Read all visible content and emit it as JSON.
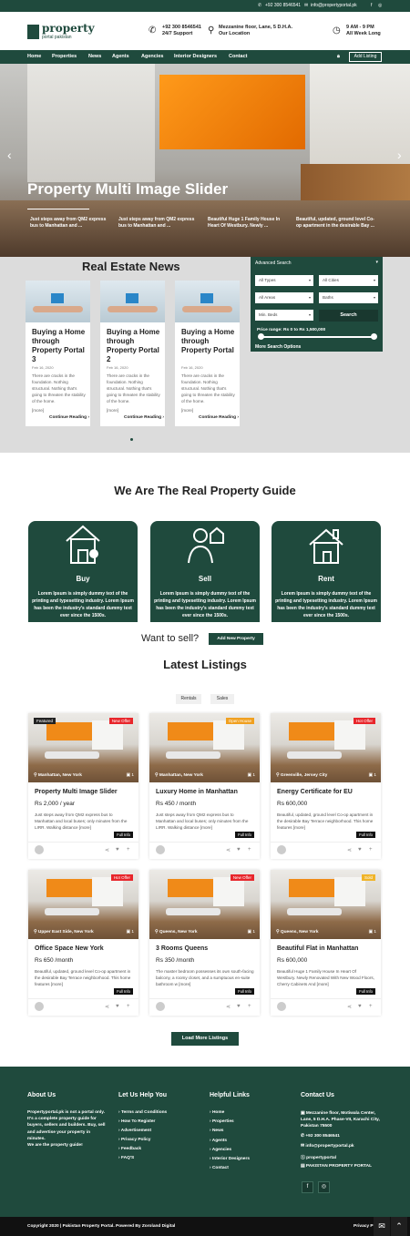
{
  "topbar": {
    "phone": "+92 300 8546541",
    "email": "info@propertyportal.pk",
    "icons": [
      "facebook-icon",
      "instagram-icon"
    ]
  },
  "header": {
    "logo_line1": "property",
    "logo_line2": "portal pakistan",
    "contact_line1": "+92 300 8546541",
    "contact_line2": "24/7 Support",
    "address_line1": "Mezzanine floor, Lane, 5 D.H.A.",
    "address_line2": "Our Location",
    "hours_line1": "9 AM - 9 PM",
    "hours_line2": "All Week Long"
  },
  "nav": {
    "items": [
      "Home",
      "Properties",
      "News",
      "Agents",
      "Agencies",
      "Interior Designers",
      "Contact"
    ],
    "add_listing": "Add Listing"
  },
  "slider": {
    "title": "Property Multi Image Slider",
    "captions": [
      "Just steps away from QM2 express bus to Manhattan and ...",
      "Just steps away from QM2 express bus to Manhattan and ...",
      "Beautiful Huge 1 Family House In Heart Of Westbury. Newly ...",
      "Beautiful, updated, ground level Co-op apartment in the desirable Bay ..."
    ],
    "prev": "‹",
    "next": "›"
  },
  "news": {
    "title": "Real Estate News",
    "cards": [
      {
        "title": "Buying a Home through Property Portal 3",
        "date": "Feb 16, 2020",
        "excerpt": "There are cracks in the foundation. Nothing structural. Nothing that's going to threaten the stability of the home.",
        "more": "[more]",
        "cta": "Continue Reading ›"
      },
      {
        "title": "Buying a Home through Property Portal 2",
        "date": "Feb 16, 2020",
        "excerpt": "There are cracks in the foundation. Nothing structural. Nothing that's going to threaten the stability of the home.",
        "more": "[more]",
        "cta": "Continue Reading ›"
      },
      {
        "title": "Buying a Home through Property Portal",
        "date": "Feb 16, 2020",
        "excerpt": "There are cracks in the foundation. Nothing structural. Nothing that's going to threaten the stability of the home.",
        "more": "[more]",
        "cta": "Continue Reading ›"
      }
    ]
  },
  "search": {
    "title": "Advanced Search",
    "types": "All Types",
    "cities": "All Cities",
    "areas": "All Areas",
    "baths": "Baths",
    "beds": "Min. Beds",
    "button": "Search",
    "price": "Price range: Rs 0 to Rs 1,500,000",
    "more": "More Search Options"
  },
  "guide": {
    "title": "We Are The Real Property Guide",
    "boxes": [
      {
        "label": "Buy",
        "text": "Lorem Ipsum is simply dummy text of the printing and typesetting industry. Lorem Ipsum has been the industry's standard dummy text ever since the 1500s."
      },
      {
        "label": "Sell",
        "text": "Lorem Ipsum is simply dummy text of the printing and typesetting industry. Lorem Ipsum has been the industry's standard dummy text ever since the 1500s."
      },
      {
        "label": "Rent",
        "text": "Lorem Ipsum is simply dummy text of the printing and typesetting industry. Lorem Ipsum has been the industry's standard dummy text ever since the 1500s."
      }
    ],
    "want": "Want to sell?",
    "add_button": "Add New Property"
  },
  "listings": {
    "title": "Latest Listings",
    "tabs": [
      "Rentals",
      "Sales"
    ],
    "load_more": "Load More Listings",
    "full_info": "Full Info",
    "items": [
      {
        "badge_left": "Featured",
        "badge_right": "New Offer",
        "badge_color": "#e8262b",
        "location": "Manhattan, New York",
        "photos": "1",
        "title": "Property Multi Image Slider",
        "price": "Rs 2,000 / year",
        "desc": "Just steps away from QM2 express bus to Manhattan and local buses; only minutes from the LIRR. Walking distance [more]"
      },
      {
        "badge_left": "",
        "badge_right": "Open House",
        "badge_color": "#f0a020",
        "location": "Manhattan, New York",
        "photos": "1",
        "title": "Luxury Home in Manhattan",
        "price": "Rs 450 / month",
        "desc": "Just steps away from QM2 express bus to Manhattan and local buses; only minutes from the LIRR. Walking distance [more]"
      },
      {
        "badge_left": "",
        "badge_right": "Hot Offer",
        "badge_color": "#e8262b",
        "location": "Greenville, Jersey City",
        "photos": "1",
        "title": "Energy Certificate for EU",
        "price": "Rs 600,000",
        "desc": "Beautiful, updated, ground level Co-op apartment in the desirable Bay Terrace neighborhood. This home features [more]"
      },
      {
        "badge_left": "",
        "badge_right": "Hot Offer",
        "badge_color": "#e8262b",
        "location": "Upper East Side, New York",
        "photos": "1",
        "title": "Office Space New York",
        "price": "Rs 650 /month",
        "desc": "Beautiful, updated, ground level Co-op apartment in the desirable Bay Terrace neighborhood. This home features [more]"
      },
      {
        "badge_left": "",
        "badge_right": "New Offer",
        "badge_color": "#e8262b",
        "location": "Queens, New York",
        "photos": "1",
        "title": "3 Rooms Queens",
        "price": "Rs 350 /month",
        "desc": "The master bedroom possesses its own south-facing balcony, a roomy closet, and a sumptuous en-suite bathroom w [more]"
      },
      {
        "badge_left": "",
        "badge_right": "Sold",
        "badge_color": "#f0b428",
        "location": "Queens, New York",
        "photos": "1",
        "title": "Beautiful Flat in Manhattan",
        "price": "Rs 600,000",
        "desc": "Beautiful Huge 1 Family House In Heart Of Westbury. Newly Renovated With New Wood Floors, Cherry Cabinets And [more]"
      }
    ]
  },
  "footer": {
    "about_title": "About Us",
    "about_text": "Propertyportal.pk is not a portal only. It's a complete property guide for buyers, sellers and builders. Buy, sell and advertise your property in minutes.",
    "about_text2": "We are the property guide!",
    "help_title": "Let Us Help You",
    "help_links": [
      "Terms and Conditions",
      "How To Register",
      "Advertisement",
      "Privacy Policy",
      "Feedback",
      "FAQ'S"
    ],
    "links_title": "Helpful Links",
    "helpful_links": [
      "Home",
      "Properties",
      "News",
      "Agents",
      "Agencies",
      "Interior Designers",
      "Contact"
    ],
    "contact_title": "Contact Us",
    "contact_address": "Mezzanine floor, Motiwala Center, Lane, 5 D.H.A. Phase-VII, Karachi City, Pakistan 75500",
    "contact_phone": "+92 300 8546541",
    "contact_email": "info@propertyportal.pk",
    "contact_skype": "propertyportal",
    "contact_company": "PAKISTAN PROPERTY PORTAL",
    "copyright": "Copyright 2020 | Pakistan Property Portal. Powered By Zoroland Digital",
    "privacy": "Privacy P"
  },
  "colors": {
    "brand": "#1f4a3d",
    "accent_red": "#e8262b",
    "accent_orange": "#f0a020"
  }
}
